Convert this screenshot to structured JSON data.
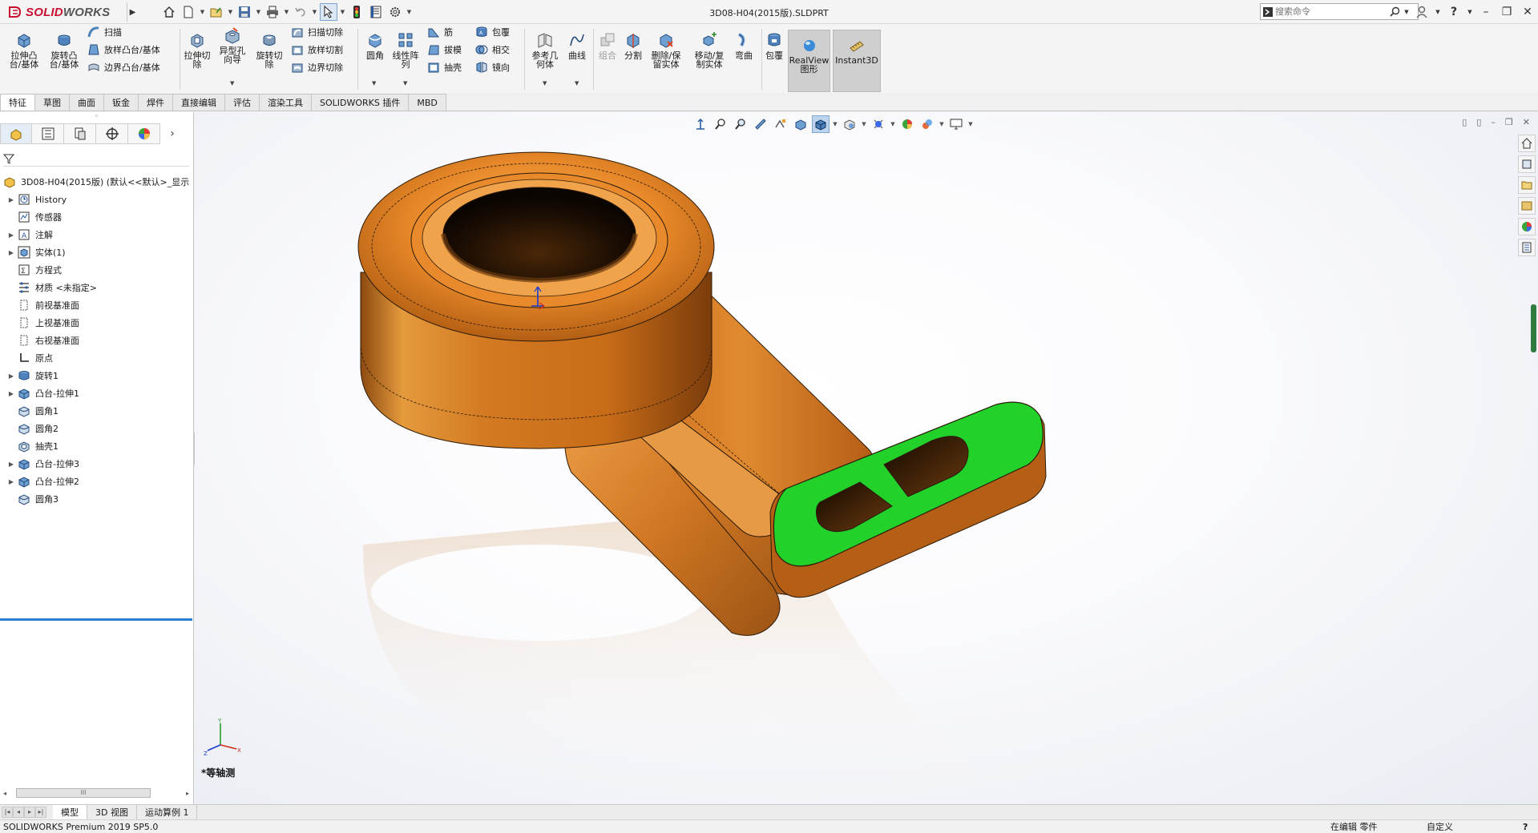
{
  "app": {
    "brand_prefix": "SOLID",
    "brand_suffix": "WORKS",
    "document_title": "3D08-H04(2015版).SLDPRT"
  },
  "search": {
    "placeholder": "搜索命令"
  },
  "quick_access": [
    "home-icon",
    "new-icon",
    "open-icon",
    "save-icon",
    "print-icon",
    "undo-icon",
    "select-icon",
    "rebuild-icon",
    "file-properties-icon",
    "options-icon"
  ],
  "command_manager": {
    "extrude_boss": "拉伸凸\n台/基体",
    "revolve_boss": "旋转凸\n台/基体",
    "sweep": "扫描",
    "loft_boss": "放样凸台/基体",
    "boundary_boss": "边界凸台/基体",
    "extrude_cut": "拉伸切\n除",
    "hole_wizard": "异型孔\n向导",
    "revolve_cut": "旋转切\n除",
    "sweep_cut": "扫描切除",
    "loft_cut": "放样切割",
    "boundary_cut": "边界切除",
    "fillet": "圆角",
    "linear_pattern": "线性阵\n列",
    "rib": "筋",
    "draft": "拔模",
    "shell": "抽壳",
    "wrap": "包覆",
    "intersect": "相交",
    "mirror": "镜向",
    "ref_geometry": "参考几\n何体",
    "curves": "曲线",
    "combine": "组合",
    "split": "分割",
    "delete_keep_body": "删除/保\n留实体",
    "move_copy_body": "移动/复\n制实体",
    "flex": "弯曲",
    "wrap2": "包覆",
    "realview": "RealView\n图形",
    "instant3d": "Instant3D"
  },
  "tabs": [
    {
      "label": "特征",
      "active": true
    },
    {
      "label": "草图"
    },
    {
      "label": "曲面"
    },
    {
      "label": "钣金"
    },
    {
      "label": "焊件"
    },
    {
      "label": "直接编辑"
    },
    {
      "label": "评估"
    },
    {
      "label": "渲染工具"
    },
    {
      "label": "SOLIDWORKS 插件"
    },
    {
      "label": "MBD"
    }
  ],
  "feature_tree": {
    "root": "3D08-H04(2015版)  (默认<<默认>_显示",
    "items": [
      {
        "label": "History",
        "icon": "history-icon",
        "expandable": true
      },
      {
        "label": "传感器",
        "icon": "sensors-icon",
        "expandable": false
      },
      {
        "label": "注解",
        "icon": "annotations-icon",
        "expandable": true
      },
      {
        "label": "实体(1)",
        "icon": "solid-bodies-icon",
        "expandable": true
      },
      {
        "label": "方程式",
        "icon": "equations-icon",
        "expandable": false
      },
      {
        "label": "材质 <未指定>",
        "icon": "material-icon",
        "expandable": false
      },
      {
        "label": "前视基准面",
        "icon": "plane-icon",
        "expandable": false
      },
      {
        "label": "上视基准面",
        "icon": "plane-icon",
        "expandable": false
      },
      {
        "label": "右视基准面",
        "icon": "plane-icon",
        "expandable": false
      },
      {
        "label": "原点",
        "icon": "origin-icon",
        "expandable": false
      },
      {
        "label": "旋转1",
        "icon": "revolve-feature-icon",
        "expandable": true
      },
      {
        "label": "凸台-拉伸1",
        "icon": "extrude-feature-icon",
        "expandable": true
      },
      {
        "label": "圆角1",
        "icon": "fillet-feature-icon",
        "expandable": false
      },
      {
        "label": "圆角2",
        "icon": "fillet-feature-icon",
        "expandable": false
      },
      {
        "label": "抽壳1",
        "icon": "shell-feature-icon",
        "expandable": false
      },
      {
        "label": "凸台-拉伸3",
        "icon": "extrude-feature-icon",
        "expandable": true
      },
      {
        "label": "凸台-拉伸2",
        "icon": "extrude-feature-icon",
        "expandable": true
      },
      {
        "label": "圆角3",
        "icon": "fillet-feature-icon",
        "expandable": false
      }
    ]
  },
  "viewport": {
    "view_name": "*等轴测",
    "triad_labels": {
      "x": "X",
      "y": "Y",
      "z": "Z"
    },
    "colors": {
      "body": "#d9781a",
      "selected_face": "#22d12a",
      "edge": "#2b1a08"
    }
  },
  "bottom_tabs": [
    {
      "label": "模型",
      "active": true
    },
    {
      "label": "3D 视图"
    },
    {
      "label": "运动算例 1"
    }
  ],
  "status_bar": {
    "product": "SOLIDWORKS Premium 2019 SP5.0",
    "editing": "在编辑 零件",
    "units": "自定义",
    "help": "?"
  }
}
